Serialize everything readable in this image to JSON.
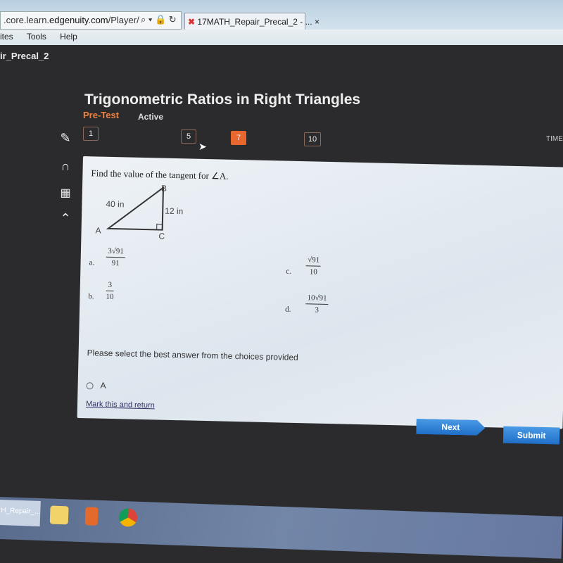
{
  "browser": {
    "url_prefix": ".core.learn.",
    "url_domain": "edgenuity.com",
    "url_path": "/Player/",
    "url_icons": "⌕ ▾ 🔒 ↻",
    "tab_title": "17MATH_Repair_Precal_2 - ...",
    "tab_close": "×",
    "menu": [
      "ites",
      "Tools",
      "Help"
    ]
  },
  "app": {
    "title": "ir_Precal_2"
  },
  "lesson": {
    "title": "Trigonometric Ratios in Right Triangles",
    "type": "Pre-Test",
    "status": "Active"
  },
  "questions": [
    {
      "label": "1",
      "current": false
    },
    {
      "label": "5",
      "current": false
    },
    {
      "label": "7",
      "current": true
    },
    {
      "label": "10",
      "current": false
    }
  ],
  "timer_label": "TIME",
  "tools": [
    "pencil-icon",
    "headphones-icon",
    "calculator-icon",
    "arrow-up-icon"
  ],
  "question": {
    "prompt": "Find the value of the tangent for ∠A.",
    "figure": {
      "vertices": [
        "A",
        "B",
        "C"
      ],
      "hypotenuse": "40 in",
      "opposite": "12 in"
    },
    "options": [
      {
        "letter": "a.",
        "num": "3√91",
        "den": "91"
      },
      {
        "letter": "b.",
        "num": "3",
        "den": "10"
      },
      {
        "letter": "c.",
        "num": "√91",
        "den": "10"
      },
      {
        "letter": "d.",
        "num": "10√91",
        "den": "3"
      }
    ],
    "instruction": "Please select the best answer from the choices provided",
    "visible_choice": "A",
    "mark_link": "Mark this and return"
  },
  "buttons": {
    "next": "Next",
    "submit": "Submit"
  },
  "taskbar": {
    "item": "H_Repair_..."
  },
  "colors": {
    "current_question": "#e8672e",
    "button": "#2a7fd6",
    "accent": "#f08040"
  }
}
